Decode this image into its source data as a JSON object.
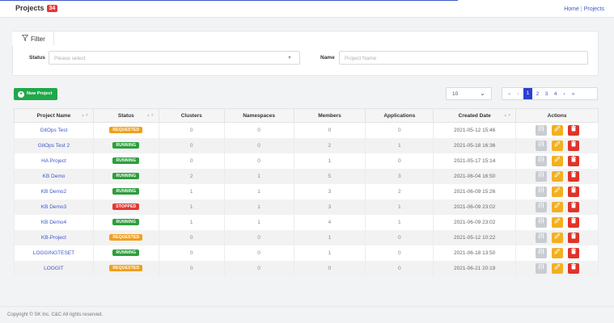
{
  "header": {
    "title": "Projects",
    "count": "34",
    "breadcrumb": [
      "Home",
      "Projects"
    ]
  },
  "filter": {
    "tab_label": "Filter",
    "status_label": "Status",
    "status_placeholder": "Please select",
    "name_label": "Name",
    "name_placeholder": "Project Name"
  },
  "toolbar": {
    "new_project_label": "New Project",
    "page_size": "10",
    "pages": [
      "1",
      "2",
      "3",
      "4"
    ],
    "current_page": "1"
  },
  "table": {
    "columns": [
      "Project Name",
      "Status",
      "Clusters",
      "Namespaces",
      "Members",
      "Applications",
      "Created Date",
      "Actions"
    ],
    "rows": [
      {
        "name": "GitOps Test",
        "status": "REQUESTED",
        "clusters": "0",
        "namespaces": "0",
        "members": "0",
        "applications": "0",
        "created": "2021-05-12 15:46"
      },
      {
        "name": "GitOps Test 2",
        "status": "RUNNING",
        "clusters": "0",
        "namespaces": "0",
        "members": "2",
        "applications": "1",
        "created": "2021-05-18 16:36"
      },
      {
        "name": "HA Project",
        "status": "RUNNING",
        "clusters": "0",
        "namespaces": "0",
        "members": "1",
        "applications": "0",
        "created": "2021-05-17 15:14"
      },
      {
        "name": "KB Demo",
        "status": "RUNNING",
        "clusters": "2",
        "namespaces": "1",
        "members": "5",
        "applications": "3",
        "created": "2021-06-04 16:50"
      },
      {
        "name": "KB Demo2",
        "status": "RUNNING",
        "clusters": "1",
        "namespaces": "1",
        "members": "3",
        "applications": "2",
        "created": "2021-06-09 15:26"
      },
      {
        "name": "KB Demo3",
        "status": "STOPPED",
        "clusters": "1",
        "namespaces": "1",
        "members": "3",
        "applications": "1",
        "created": "2021-06-09 23:02"
      },
      {
        "name": "KB Demo4",
        "status": "RUNNING",
        "clusters": "1",
        "namespaces": "1",
        "members": "4",
        "applications": "1",
        "created": "2021-06-09 23:02"
      },
      {
        "name": "KB-Project",
        "status": "REQUESTED",
        "clusters": "0",
        "namespaces": "0",
        "members": "1",
        "applications": "0",
        "created": "2021-05-12 10:22"
      },
      {
        "name": "LOGGINGTESET",
        "status": "RUNNING",
        "clusters": "0",
        "namespaces": "0",
        "members": "1",
        "applications": "0",
        "created": "2021-06-18 13:50"
      },
      {
        "name": "LOGGIT",
        "status": "REQUESTED",
        "clusters": "0",
        "namespaces": "0",
        "members": "0",
        "applications": "0",
        "created": "2021-06-21 20:19"
      }
    ]
  },
  "footer": {
    "copyright": "Copyright © SK Inc. C&C All rights reserved."
  },
  "colors": {
    "accent": "#3d58c9",
    "running": "#2e9e3d",
    "requested": "#f0a020",
    "stopped": "#e53935",
    "new_button": "#1fa84a"
  },
  "icons": {
    "filter": "funnel-icon",
    "new": "plus-circle-icon",
    "config": "sliders-icon",
    "edit": "pencil-icon",
    "delete": "trash-icon"
  }
}
